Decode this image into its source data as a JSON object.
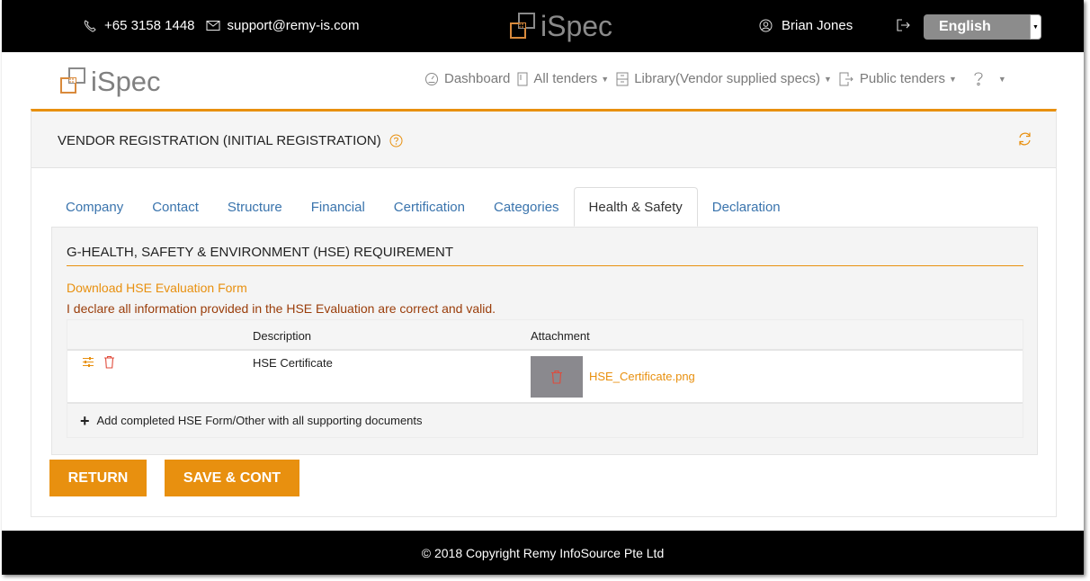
{
  "topbar": {
    "phone": "+65 3158 1448",
    "email": "support@remy-is.com",
    "logo_text": "iSpec",
    "user_name": "Brian Jones",
    "language": "English"
  },
  "navbar": {
    "logo_text": "iSpec",
    "items": [
      {
        "label": "Dashboard",
        "icon": "dashboard-icon",
        "dropdown": false
      },
      {
        "label": "All tenders",
        "icon": "document-icon",
        "dropdown": true
      },
      {
        "label": "Library(Vendor supplied specs)",
        "icon": "cabinet-icon",
        "dropdown": true
      },
      {
        "label": "Public tenders",
        "icon": "export-file-icon",
        "dropdown": true
      }
    ],
    "help_icon": "question-icon"
  },
  "card": {
    "title": "VENDOR REGISTRATION (INITIAL REGISTRATION)",
    "tabs": [
      {
        "label": "Company",
        "active": false
      },
      {
        "label": "Contact",
        "active": false
      },
      {
        "label": "Structure",
        "active": false
      },
      {
        "label": "Financial",
        "active": false
      },
      {
        "label": "Certification",
        "active": false
      },
      {
        "label": "Categories",
        "active": false
      },
      {
        "label": "Health & Safety",
        "active": true
      },
      {
        "label": "Declaration",
        "active": false
      }
    ]
  },
  "panel": {
    "section_title": "G-HEALTH, SAFETY & ENVIRONMENT (HSE) REQUIREMENT",
    "download_link": "Download HSE Evaluation Form",
    "declaration": "I declare all information provided in the HSE Evaluation are correct and valid.",
    "table": {
      "headers": [
        "",
        "Description",
        "Attachment"
      ],
      "rows": [
        {
          "description": "HSE Certificate",
          "attachment": "HSE_Certificate.png"
        }
      ],
      "add_label": "Add completed HSE Form/Other with all supporting documents"
    }
  },
  "buttons": {
    "return_label": "RETURN",
    "save_label": "SAVE & CONT"
  },
  "footer": {
    "copyright": "© 2018 Copyright  Remy InfoSource Pte Ltd"
  },
  "colors": {
    "accent": "#e8900f",
    "link": "#3a74ad",
    "declaration": "#9a3d0a",
    "danger": "#e04a3a"
  }
}
